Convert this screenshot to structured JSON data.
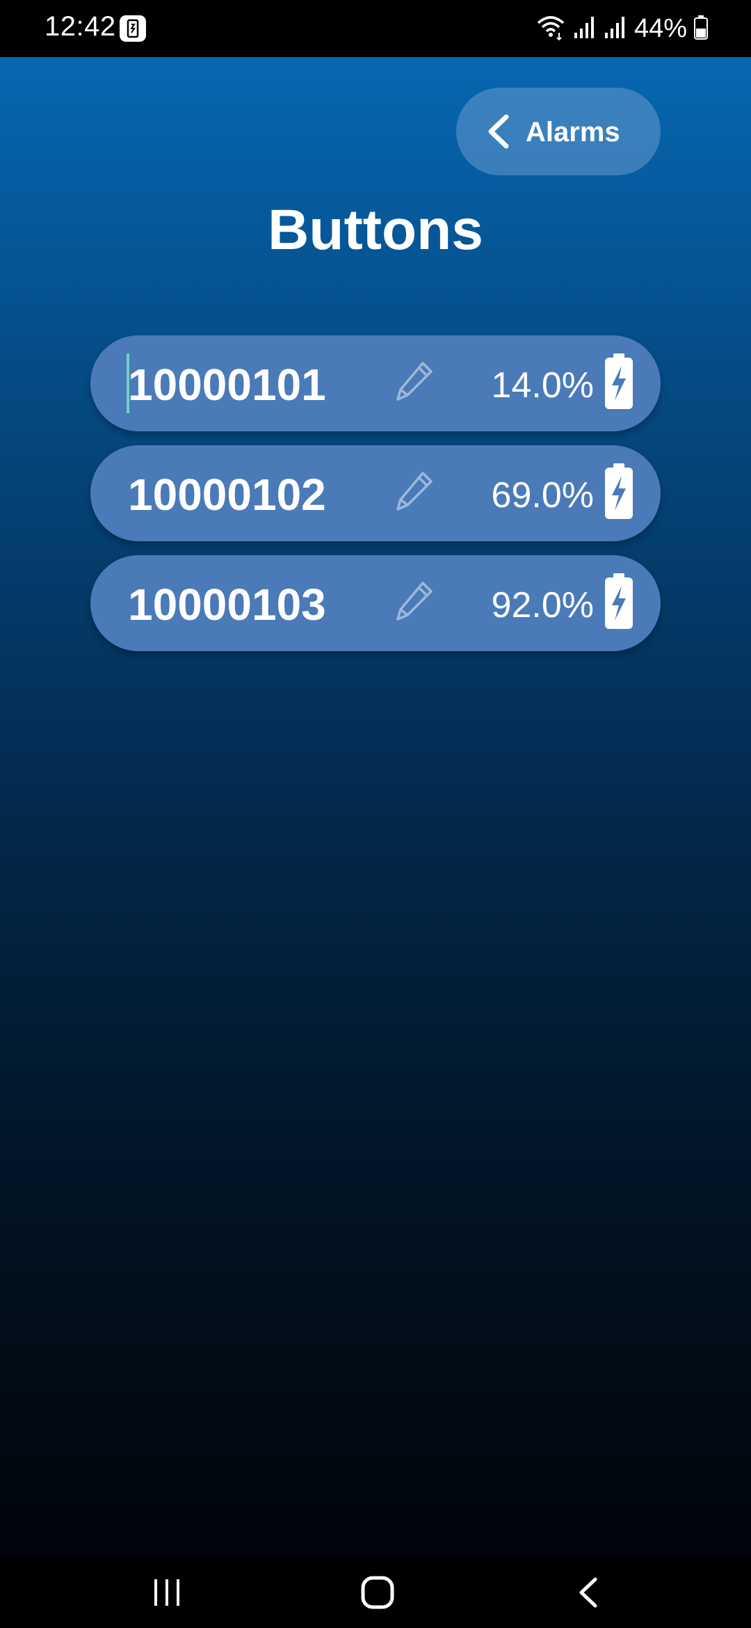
{
  "status_bar": {
    "time": "12:42",
    "battery_percent": "44%",
    "icons": [
      "app-notification-icon",
      "wifi-icon",
      "signal-icon",
      "signal-icon",
      "battery-icon"
    ]
  },
  "header": {
    "back_label": "Alarms",
    "title": "Buttons"
  },
  "buttons": [
    {
      "id": "10000101",
      "battery": "14.0%"
    },
    {
      "id": "10000102",
      "battery": "69.0%"
    },
    {
      "id": "10000103",
      "battery": "92.0%"
    }
  ],
  "nav_bar": {
    "icons": [
      "recent-apps-icon",
      "home-icon",
      "back-icon"
    ]
  },
  "colors": {
    "gradient_top": "#0667b1",
    "gradient_bottom": "#010409",
    "row_background": "#4a7ab8",
    "cursor": "#6fd1c8"
  }
}
